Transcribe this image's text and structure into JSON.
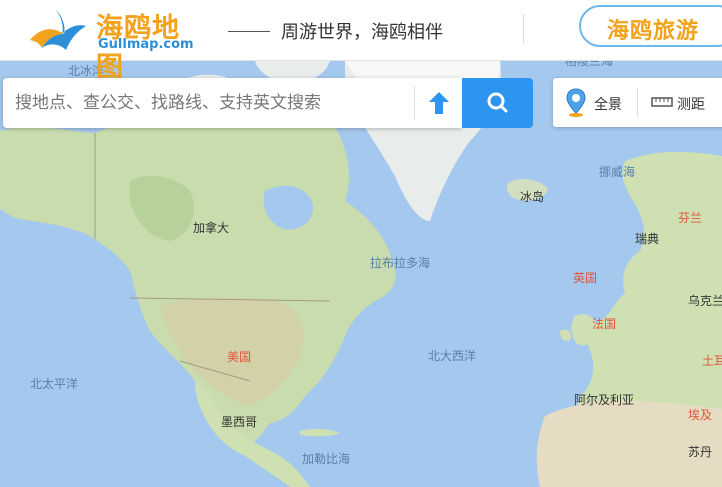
{
  "header": {
    "logo_cn": "海鸥地图",
    "logo_en": "Gullmap.com",
    "slogan": "周游世界，海鸥相伴",
    "brand_button": "海鸥旅游"
  },
  "search": {
    "placeholder": "搜地点、查公交、找路线、支持英文搜索"
  },
  "tools": {
    "panorama": "全景",
    "measure": "测距"
  },
  "map_labels": {
    "arctic_ocean": "北冰洋",
    "greenland_sea": "格陵兰海",
    "canada": "加拿大",
    "labrador_sea": "拉布拉多海",
    "iceland": "冰岛",
    "norwegian_sea": "挪威海",
    "finland": "芬兰",
    "sweden": "瑞典",
    "uk": "英国",
    "ukraine": "乌克兰",
    "france": "法国",
    "turkey": "土耳",
    "usa": "美国",
    "north_atlantic": "北大西洋",
    "north_pacific": "北太平洋",
    "mexico": "墨西哥",
    "algeria": "阿尔及利亚",
    "egypt": "埃及",
    "caribbean": "加勒比海",
    "sudan": "苏丹"
  }
}
